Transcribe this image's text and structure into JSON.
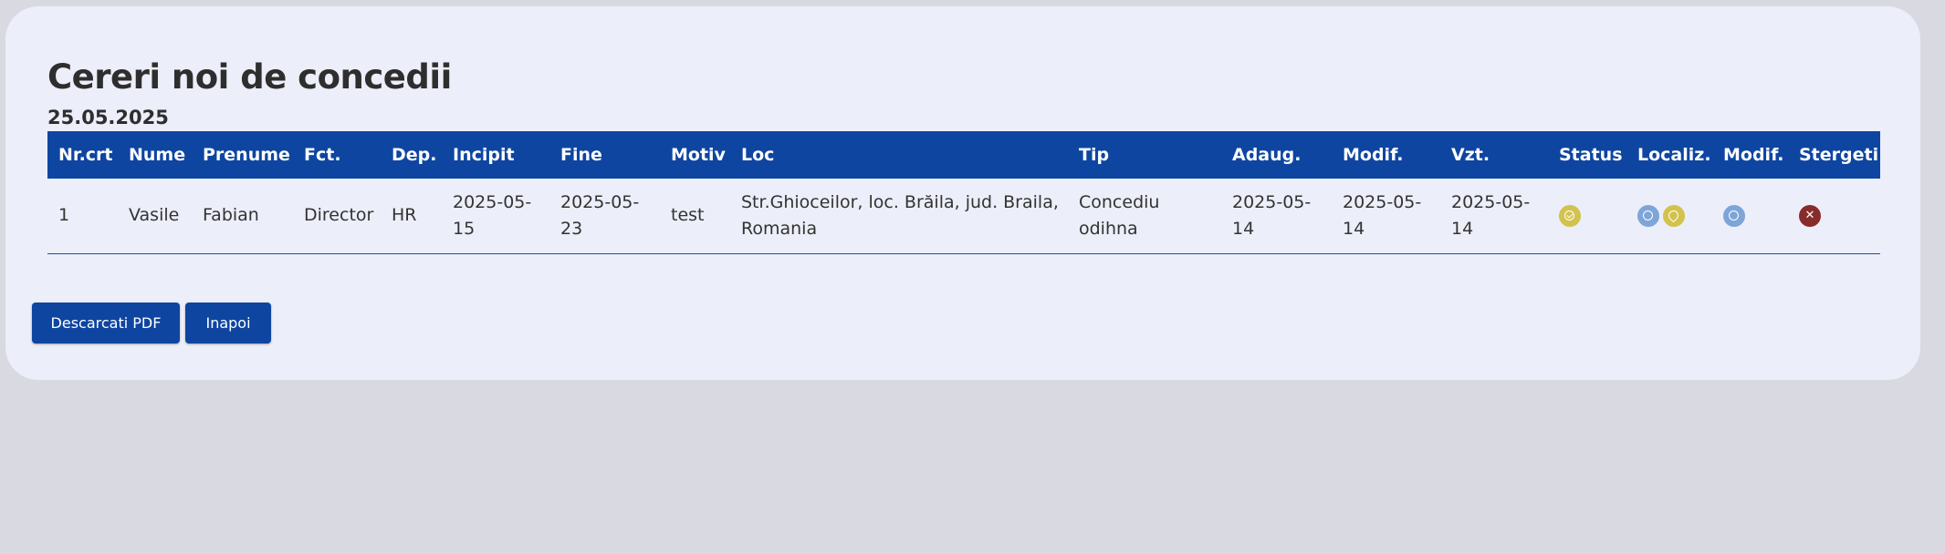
{
  "page": {
    "title": "Cereri noi de concedii",
    "date": "25.05.2025"
  },
  "table": {
    "headers": [
      "Nr.crt",
      "Nume",
      "Prenume",
      "Fct.",
      "Dep.",
      "Incipit",
      "Fine",
      "Motiv",
      "Loc",
      "Tip",
      "Adaug.",
      "Modif.",
      "Vzt.",
      "Status",
      "Localiz.",
      "Modif.",
      "Stergeti"
    ],
    "rows": [
      {
        "nr": "1",
        "nume": "Vasile",
        "prenume": "Fabian",
        "fct": "Director",
        "dep": "HR",
        "incipit": "2025-05-15",
        "fine": "2025-05-23",
        "motiv": "test",
        "loc": "Str.Ghioceilor, loc. Brăila, jud. Braila, Romania",
        "tip": "Concediu odihna",
        "adaug": "2025-05-14",
        "modif": "2025-05-14",
        "vzt": "2025-05-14"
      }
    ]
  },
  "icons": {
    "status": "check-circle-icon",
    "localiz": [
      "refresh-icon",
      "map-pin-icon"
    ],
    "modif": "refresh-icon",
    "stergeti": "close-icon"
  },
  "colors": {
    "primary": "#0e45a1",
    "status_yellow": "#d2c24e",
    "icon_blue": "#7ea5d8",
    "delete_red": "#872b2b"
  },
  "buttons": {
    "pdf": "Descarcati PDF",
    "back": "Inapoi"
  }
}
